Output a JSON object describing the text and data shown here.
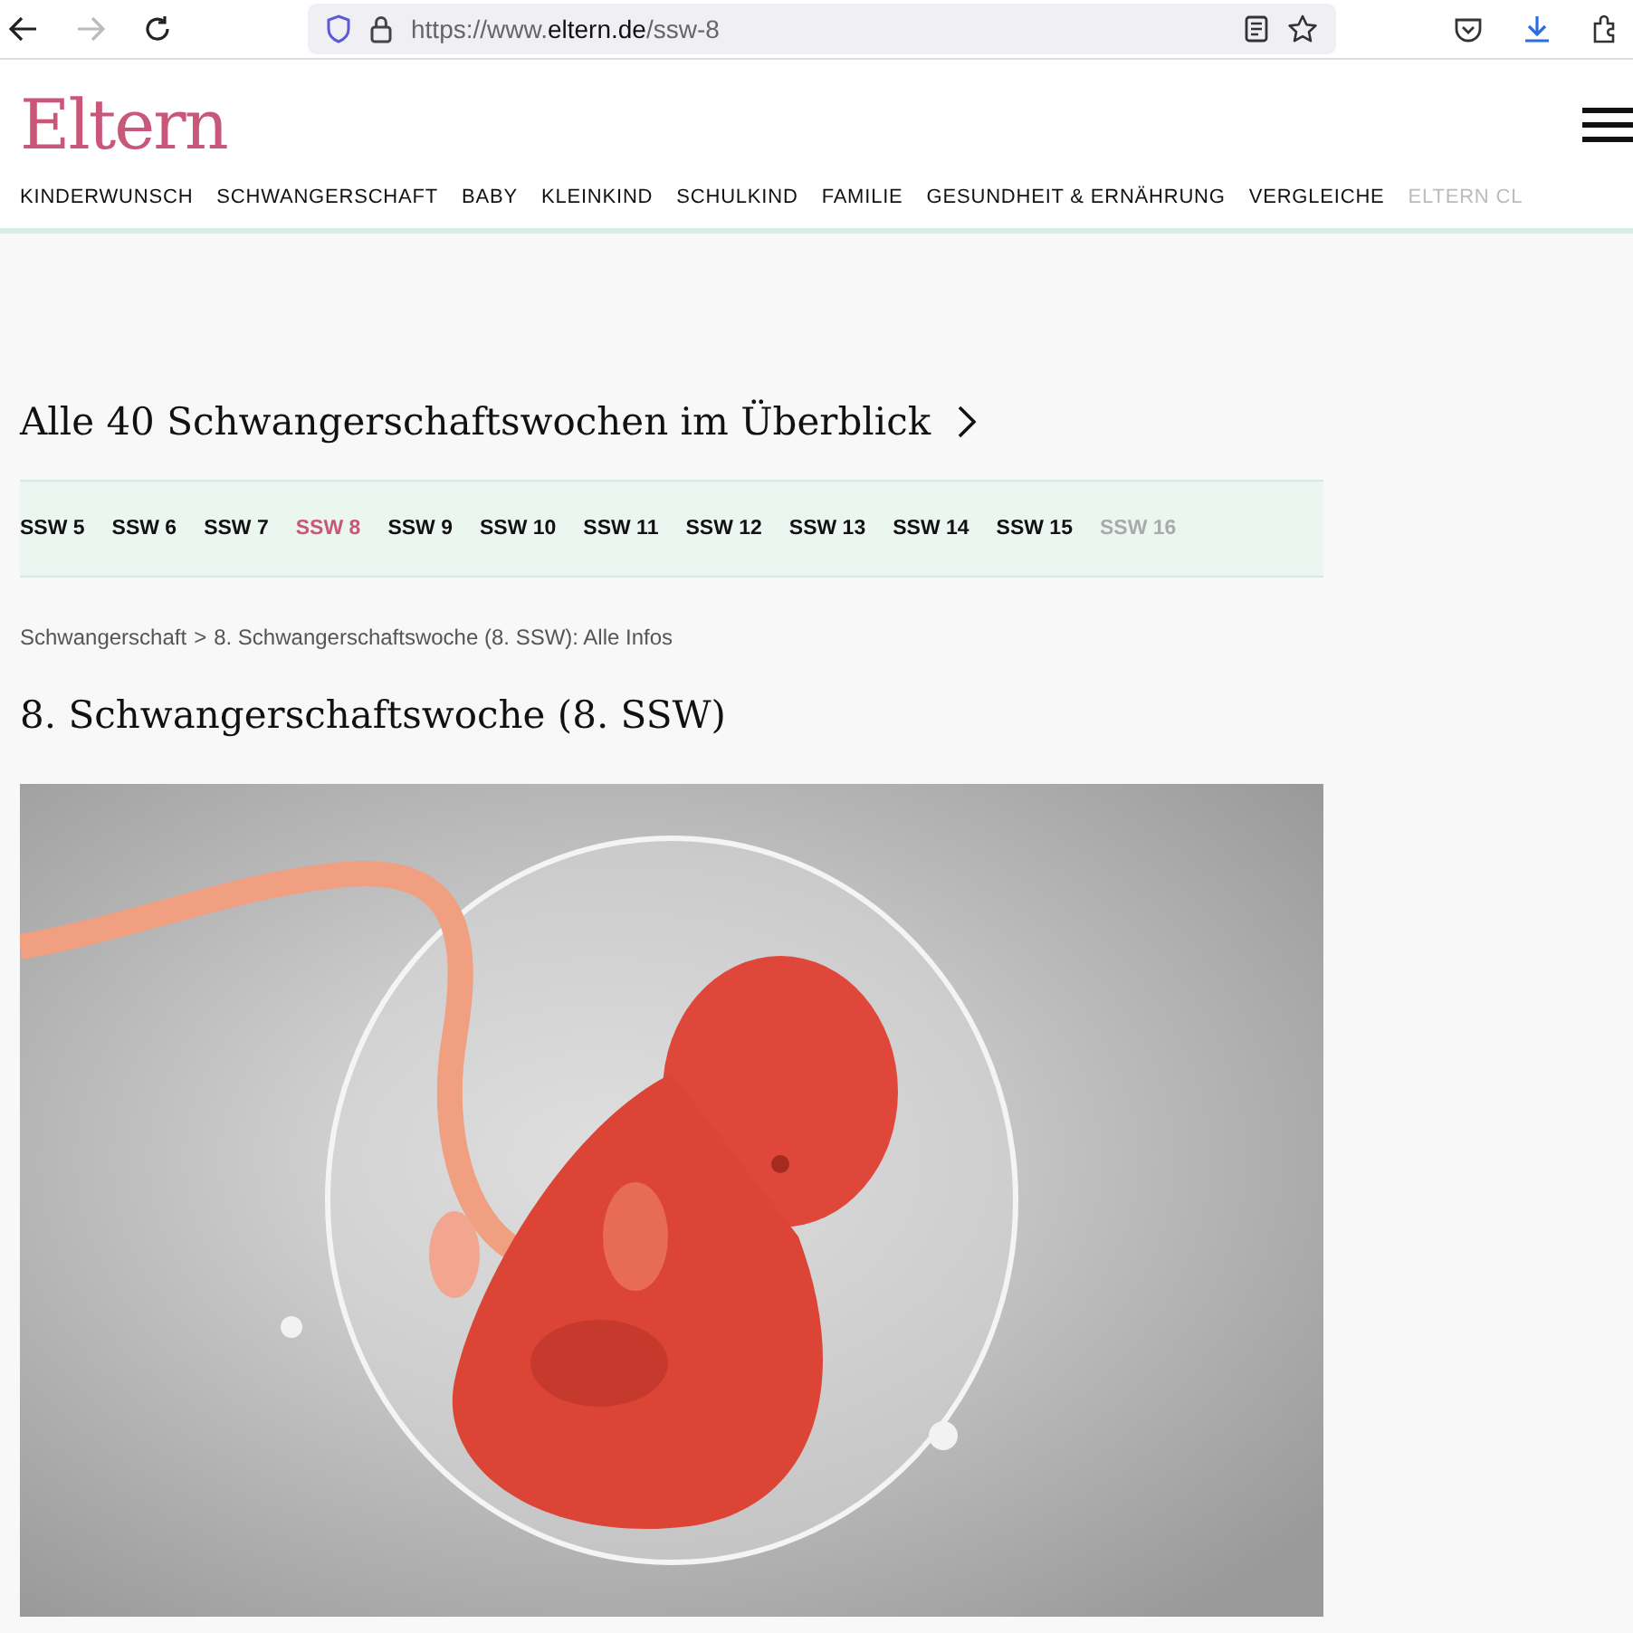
{
  "browser": {
    "back_disabled": false,
    "forward_disabled": true,
    "url": {
      "scheme": "https://www.",
      "domain": "eltern.de",
      "path": "/ssw-8"
    }
  },
  "site": {
    "logo": "Eltern",
    "nav": [
      {
        "label": "KINDERWUNSCH",
        "faded": false
      },
      {
        "label": "SCHWANGERSCHAFT",
        "faded": false
      },
      {
        "label": "BABY",
        "faded": false
      },
      {
        "label": "KLEINKIND",
        "faded": false
      },
      {
        "label": "SCHULKIND",
        "faded": false
      },
      {
        "label": "FAMILIE",
        "faded": false
      },
      {
        "label": "GESUNDHEIT & ERNÄHRUNG",
        "faded": false
      },
      {
        "label": "VERGLEICHE",
        "faded": false
      },
      {
        "label": "ELTERN CL",
        "faded": true
      }
    ]
  },
  "overview_link": "Alle 40 Schwangerschaftswochen im Überblick",
  "weeks": [
    {
      "label": "SSW 5",
      "selected": false,
      "faded": false
    },
    {
      "label": "SSW 6",
      "selected": false,
      "faded": false
    },
    {
      "label": "SSW 7",
      "selected": false,
      "faded": false
    },
    {
      "label": "SSW 8",
      "selected": true,
      "faded": false
    },
    {
      "label": "SSW 9",
      "selected": false,
      "faded": false
    },
    {
      "label": "SSW 10",
      "selected": false,
      "faded": false
    },
    {
      "label": "SSW 11",
      "selected": false,
      "faded": false
    },
    {
      "label": "SSW 12",
      "selected": false,
      "faded": false
    },
    {
      "label": "SSW 13",
      "selected": false,
      "faded": false
    },
    {
      "label": "SSW 14",
      "selected": false,
      "faded": false
    },
    {
      "label": "SSW 15",
      "selected": false,
      "faded": false
    },
    {
      "label": "SSW 16",
      "selected": false,
      "faded": true
    }
  ],
  "breadcrumb": {
    "link": "Schwangerschaft",
    "separator": ">",
    "current": "8. Schwangerschaftswoche (8. SSW): Alle Infos"
  },
  "heading": "8. Schwangerschaftswoche (8. SSW)"
}
